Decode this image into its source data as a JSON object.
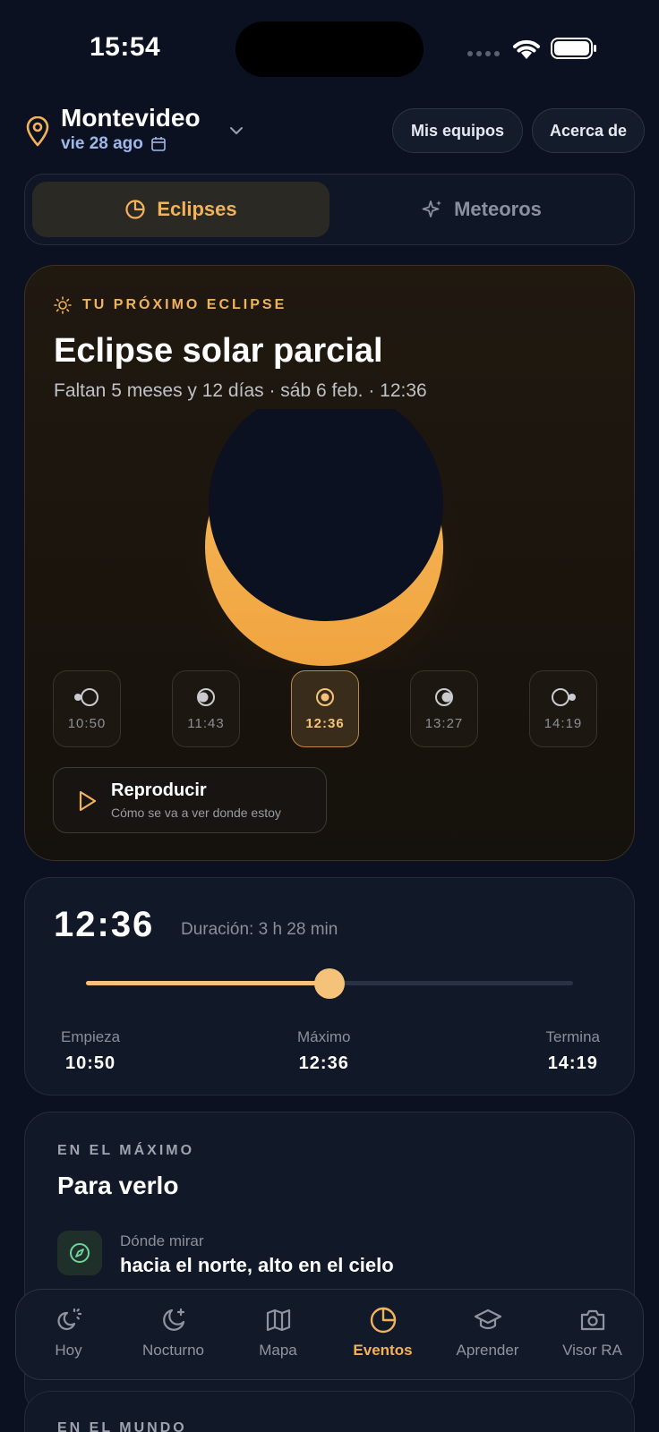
{
  "status": {
    "time": "15:54"
  },
  "header": {
    "city": "Montevideo",
    "date": "vie 28 ago",
    "my_gear_label": "Mis equipos",
    "about_label": "Acerca de"
  },
  "segment": {
    "eclipses_label": "Eclipses",
    "meteors_label": "Meteoros",
    "selected": "Eclipses"
  },
  "hero": {
    "eyebrow": "TU PRÓXIMO ECLIPSE",
    "title": "Eclipse solar parcial",
    "subtitle": "Faltan 5 meses y 12 días · sáb 6 feb. · 12:36",
    "stages": [
      {
        "time": "10:50",
        "icon": "phase-start-icon"
      },
      {
        "time": "11:43",
        "icon": "phase-partial-icon"
      },
      {
        "time": "12:36",
        "icon": "phase-max-icon",
        "active": true
      },
      {
        "time": "13:27",
        "icon": "phase-partial-out-icon"
      },
      {
        "time": "14:19",
        "icon": "phase-end-icon"
      }
    ],
    "play_label": "Reproducir",
    "play_sub": "Cómo se va a ver donde estoy"
  },
  "timing": {
    "current_time": "12:36",
    "duration": "Duración: 3 h 28 min",
    "progress": 0.5,
    "start_label": "Empieza",
    "start_value": "10:50",
    "max_label": "Máximo",
    "max_value": "12:36",
    "end_label": "Termina",
    "end_value": "14:19"
  },
  "max_card": {
    "eyebrow": "EN EL MÁXIMO",
    "title": "Para verlo",
    "look_label": "Dónde mirar",
    "look_value": "hacia el norte, alto en el cielo"
  },
  "world_card": {
    "eyebrow": "EN EL MUNDO"
  },
  "tabbar": {
    "tabs": [
      {
        "label": "Hoy",
        "icon": "sun-moon-icon"
      },
      {
        "label": "Nocturno",
        "icon": "moon-star-icon"
      },
      {
        "label": "Mapa",
        "icon": "map-icon"
      },
      {
        "label": "Eventos",
        "icon": "eclipse-icon",
        "active": true
      },
      {
        "label": "Aprender",
        "icon": "graduation-cap-icon"
      },
      {
        "label": "Visor RA",
        "icon": "camera-icon"
      }
    ]
  },
  "colors": {
    "accent": "#f2b25a",
    "background": "#0b1120",
    "card": "#111827"
  }
}
